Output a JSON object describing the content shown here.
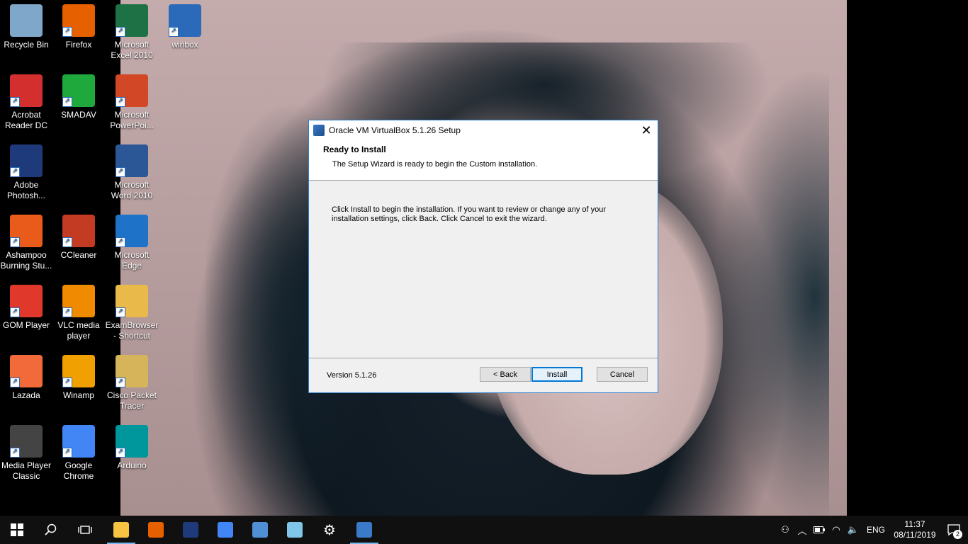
{
  "desktop_icons": [
    {
      "label": "Recycle Bin",
      "icon": "recycle-bin-icon",
      "color": "#7fa7c9"
    },
    {
      "label": "Firefox",
      "icon": "firefox-icon",
      "color": "#e66000"
    },
    {
      "label": "Microsoft Excel 2010",
      "icon": "excel-icon",
      "color": "#1e7145"
    },
    {
      "label": "winbox",
      "icon": "winbox-icon",
      "color": "#2a6ab8"
    },
    {
      "label": "Acrobat Reader DC",
      "icon": "acrobat-icon",
      "color": "#d32f2f"
    },
    {
      "label": "SMADAV",
      "icon": "smadav-icon",
      "color": "#1fa83c"
    },
    {
      "label": "Microsoft PowerPoi...",
      "icon": "powerpoint-icon",
      "color": "#d24726"
    },
    {
      "label": "Adobe Photosh...",
      "icon": "photoshop-icon",
      "color": "#1f3a7a"
    },
    {
      "label": "Microsoft Word 2010",
      "icon": "word-icon",
      "color": "#2b5797"
    },
    {
      "label": "Ashampoo Burning Stu...",
      "icon": "ashampoo-icon",
      "color": "#e85b1a"
    },
    {
      "label": "CCleaner",
      "icon": "ccleaner-icon",
      "color": "#c23b22"
    },
    {
      "label": "Microsoft Edge",
      "icon": "edge-icon",
      "color": "#1e73c8"
    },
    {
      "label": "GOM Player",
      "icon": "gom-player-icon",
      "color": "#e0392b"
    },
    {
      "label": "VLC media player",
      "icon": "vlc-icon",
      "color": "#f08a00"
    },
    {
      "label": "ExamBrowser - Shortcut",
      "icon": "exambrowser-icon",
      "color": "#e9b94a"
    },
    {
      "label": "Lazada",
      "icon": "lazada-icon",
      "color": "#f26a3a"
    },
    {
      "label": "Winamp",
      "icon": "winamp-icon",
      "color": "#f0a000"
    },
    {
      "label": "Cisco Packet Tracer",
      "icon": "packet-tracer-icon",
      "color": "#d6b55a"
    },
    {
      "label": "Media Player Classic",
      "icon": "mpc-icon",
      "color": "#444444"
    },
    {
      "label": "Google Chrome",
      "icon": "chrome-icon",
      "color": "#4285f4"
    },
    {
      "label": "Arduino",
      "icon": "arduino-icon",
      "color": "#00979c"
    }
  ],
  "dialog": {
    "title": "Oracle VM VirtualBox 5.1.26 Setup",
    "heading": "Ready to Install",
    "subheading": "The Setup Wizard is ready to begin the Custom installation.",
    "message": "Click Install to begin the installation. If you want to review or change any of your installation settings, click Back. Click Cancel to exit the wizard.",
    "version": "Version 5.1.26",
    "back_label": "< Back",
    "install_label": "Install",
    "cancel_label": "Cancel"
  },
  "taskbar": {
    "pinned": [
      {
        "icon": "file-explorer-icon",
        "color": "#f6c343",
        "active": true
      },
      {
        "icon": "firefox-icon",
        "color": "#e66000",
        "active": false
      },
      {
        "icon": "photoshop-icon",
        "color": "#1f3a7a",
        "active": false
      },
      {
        "icon": "chrome-icon",
        "color": "#4285f4",
        "active": false
      },
      {
        "icon": "paint-icon",
        "color": "#4f8fd4",
        "active": false
      },
      {
        "icon": "notepad-icon",
        "color": "#7fc6e8",
        "active": false
      },
      {
        "icon": "settings-icon",
        "color": "#ffffff",
        "active": false
      },
      {
        "icon": "virtualbox-setup-icon",
        "color": "#3a7ac8",
        "active": true
      }
    ],
    "language": "ENG",
    "time": "11:37",
    "date": "08/11/2019",
    "notification_count": "2"
  }
}
